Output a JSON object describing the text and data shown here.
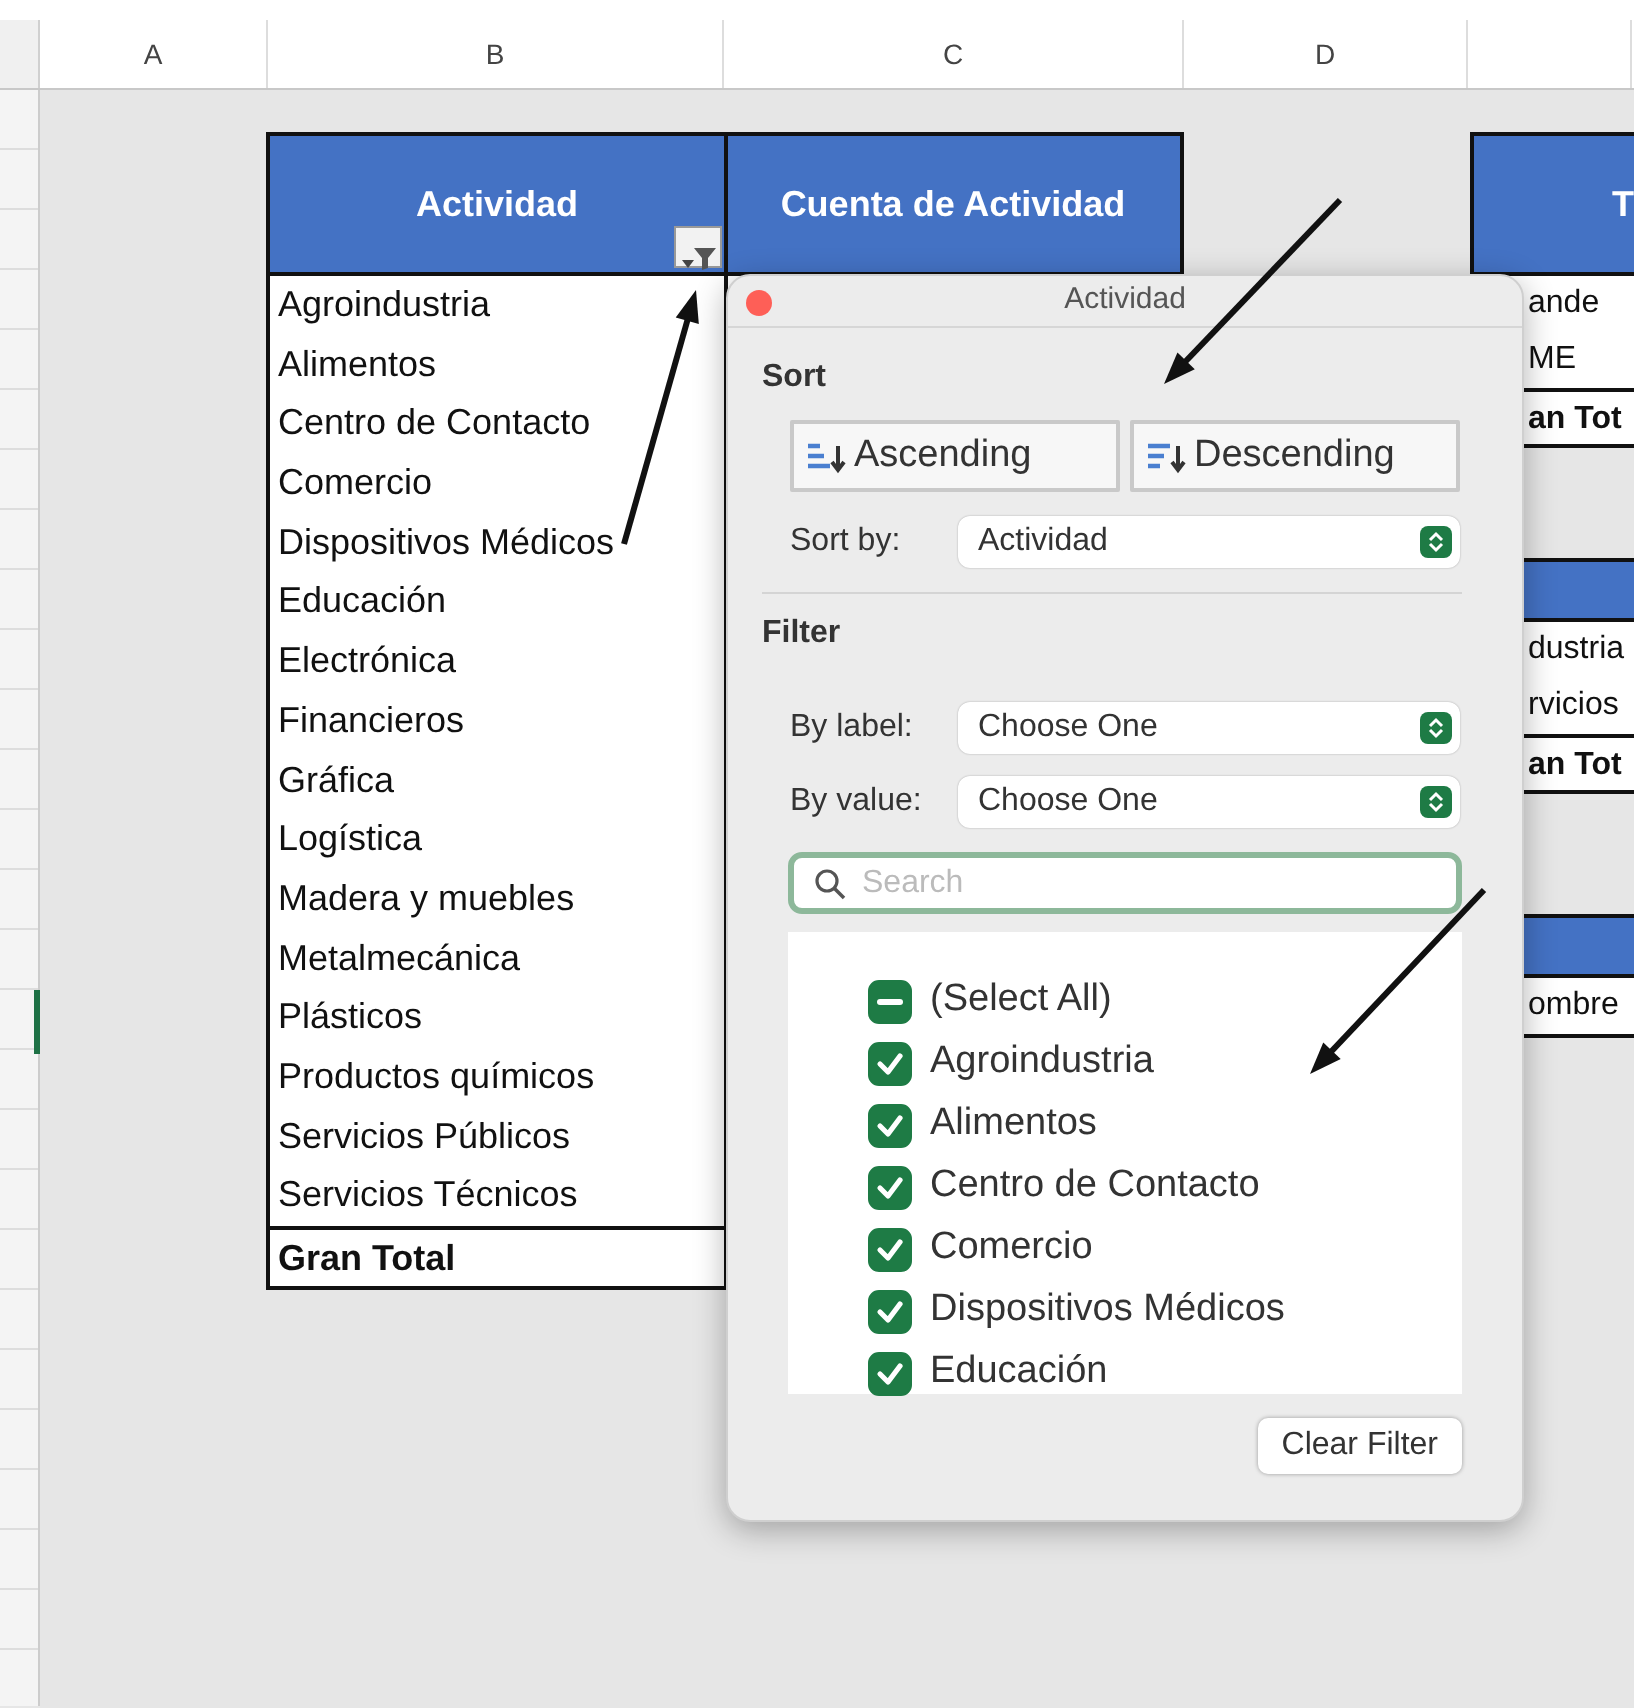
{
  "columns": [
    {
      "label": "A"
    },
    {
      "label": "B"
    },
    {
      "label": "C"
    },
    {
      "label": "D"
    }
  ],
  "pivot": {
    "headers": [
      "Actividad",
      "Cuenta de Actividad"
    ],
    "rows": [
      "Agroindustria",
      "Alimentos",
      "Centro de Contacto",
      "Comercio",
      "Dispositivos Médicos",
      "Educación",
      "Electrónica",
      "Financieros",
      "Gráfica",
      "Logística",
      "Madera y muebles",
      "Metalmecánica",
      "Plásticos",
      "Productos químicos",
      "Servicios Públicos",
      "Servicios Técnicos"
    ],
    "total": "Gran Total"
  },
  "side_tables": [
    {
      "header": "T",
      "rows": [
        "ande",
        "ME"
      ],
      "total": "an Tot"
    },
    {
      "rows": [
        "dustria",
        "rvicios"
      ],
      "total": "an Tot"
    },
    {
      "rows": [
        "ombre"
      ]
    }
  ],
  "popover": {
    "title": "Actividad",
    "sort_heading": "Sort",
    "sort_buttons": [
      {
        "label": "Ascending",
        "kind": "ascending"
      },
      {
        "label": "Descending",
        "kind": "descending"
      }
    ],
    "sort_by": {
      "label": "Sort by:",
      "value": "Actividad"
    },
    "filter_heading": "Filter",
    "filters": [
      {
        "label": "By label:",
        "value": "Choose One"
      },
      {
        "label": "By value:",
        "value": "Choose One"
      }
    ],
    "search": {
      "placeholder": "Search"
    },
    "items": [
      {
        "label": "(Select All)",
        "checked": false,
        "indeterminate": true
      },
      {
        "label": "Agroindustria",
        "checked": true,
        "indeterminate": false
      },
      {
        "label": "Alimentos",
        "checked": true,
        "indeterminate": false
      },
      {
        "label": "Centro de Contacto",
        "checked": true,
        "indeterminate": false
      },
      {
        "label": "Comercio",
        "checked": true,
        "indeterminate": false
      },
      {
        "label": "Dispositivos Médicos",
        "checked": true,
        "indeterminate": false
      },
      {
        "label": "Educación",
        "checked": true,
        "indeterminate": false
      }
    ],
    "clear_button": "Clear Filter"
  }
}
